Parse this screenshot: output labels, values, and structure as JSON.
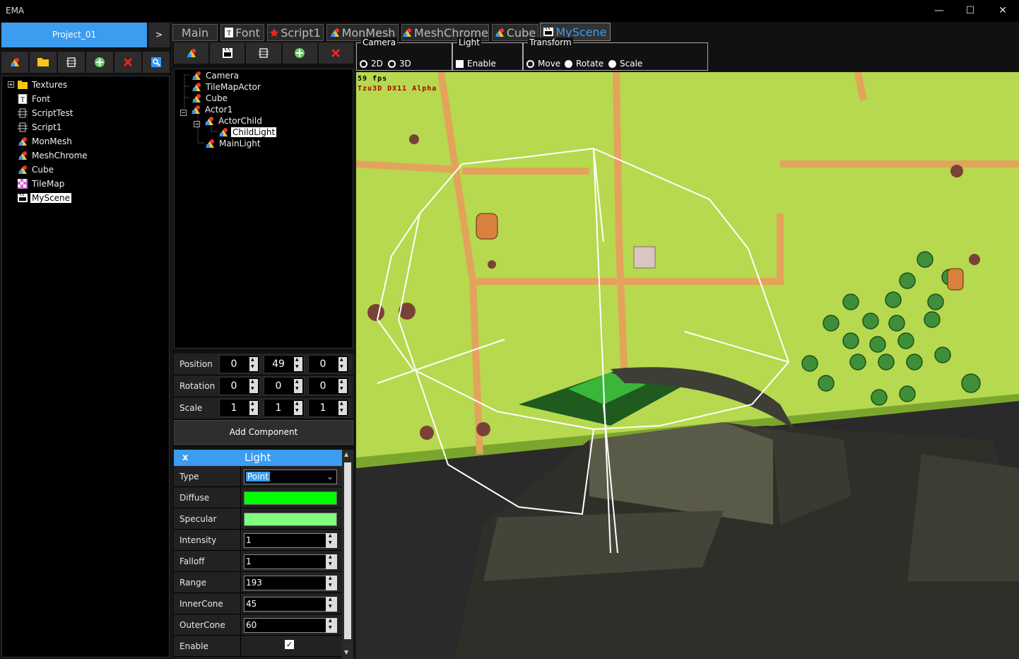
{
  "window": {
    "title": "EMA",
    "minimize": "—",
    "maximize": "☐",
    "close": "✕"
  },
  "project": {
    "name": "Project_01",
    "expand": ">"
  },
  "project_tree": [
    {
      "label": "Textures",
      "icon": "folder-icon",
      "expandable": true
    },
    {
      "label": "Font",
      "icon": "font-icon"
    },
    {
      "label": "ScriptTest",
      "icon": "script-icon"
    },
    {
      "label": "Script1",
      "icon": "script-icon"
    },
    {
      "label": "MonMesh",
      "icon": "mesh-icon"
    },
    {
      "label": "MeshChrome",
      "icon": "mesh-icon"
    },
    {
      "label": "Cube",
      "icon": "mesh-icon"
    },
    {
      "label": "TileMap",
      "icon": "tilemap-icon"
    },
    {
      "label": "MyScene",
      "icon": "scene-icon",
      "selected": true
    }
  ],
  "tabs": [
    {
      "label": "Main",
      "icon": ""
    },
    {
      "label": "Font",
      "icon": "font-icon"
    },
    {
      "label": "Script1",
      "icon": "script-icon"
    },
    {
      "label": "MonMesh",
      "icon": "mesh-icon"
    },
    {
      "label": "MeshChrome",
      "icon": "mesh-icon"
    },
    {
      "label": "Cube",
      "icon": "mesh-icon"
    },
    {
      "label": "MyScene",
      "icon": "scene-icon",
      "active": true
    }
  ],
  "scene_tree": [
    {
      "label": "Camera",
      "depth": 0
    },
    {
      "label": "TileMapActor",
      "depth": 0
    },
    {
      "label": "Cube",
      "depth": 0
    },
    {
      "label": "Actor1",
      "depth": 0,
      "expanded": true
    },
    {
      "label": "ActorChild",
      "depth": 1,
      "expanded": true
    },
    {
      "label": "ChildLight",
      "depth": 2,
      "selected": true
    },
    {
      "label": "MainLight",
      "depth": 1
    }
  ],
  "transform": {
    "position_label": "Position",
    "position": [
      "0",
      "49",
      "0"
    ],
    "rotation_label": "Rotation",
    "rotation": [
      "0",
      "0",
      "0"
    ],
    "scale_label": "Scale",
    "scale": [
      "1",
      "1",
      "1"
    ]
  },
  "add_component_label": "Add Component",
  "light": {
    "close": "x",
    "title": "Light",
    "type_label": "Type",
    "type_value": "Point",
    "diffuse_label": "Diffuse",
    "diffuse_color": "#00ff00",
    "specular_label": "Specular",
    "specular_color": "#80ff80",
    "intensity_label": "Intensity",
    "intensity": "1",
    "falloff_label": "Falloff",
    "falloff": "1",
    "range_label": "Range",
    "range": "193",
    "innercone_label": "InnerCone",
    "innercone": "45",
    "outercone_label": "OuterCone",
    "outercone": "60",
    "enable_label": "Enable",
    "enabled": true
  },
  "viewport_controls": {
    "camera_title": "Camera",
    "camera_2d": "2D",
    "camera_3d": "3D",
    "camera_mode": "3D",
    "light_title": "Light",
    "light_enable": "Enable",
    "transform_title": "Transform",
    "move": "Move",
    "rotate": "Rotate",
    "scale": "Scale",
    "transform_mode": "Move"
  },
  "viewport": {
    "fps": "59 fps",
    "engine": "Tzu3D DX11 Alpha"
  },
  "colors": {
    "accent": "#3b9cf0",
    "grass": "#b6d94f",
    "path": "#e3a35b"
  }
}
